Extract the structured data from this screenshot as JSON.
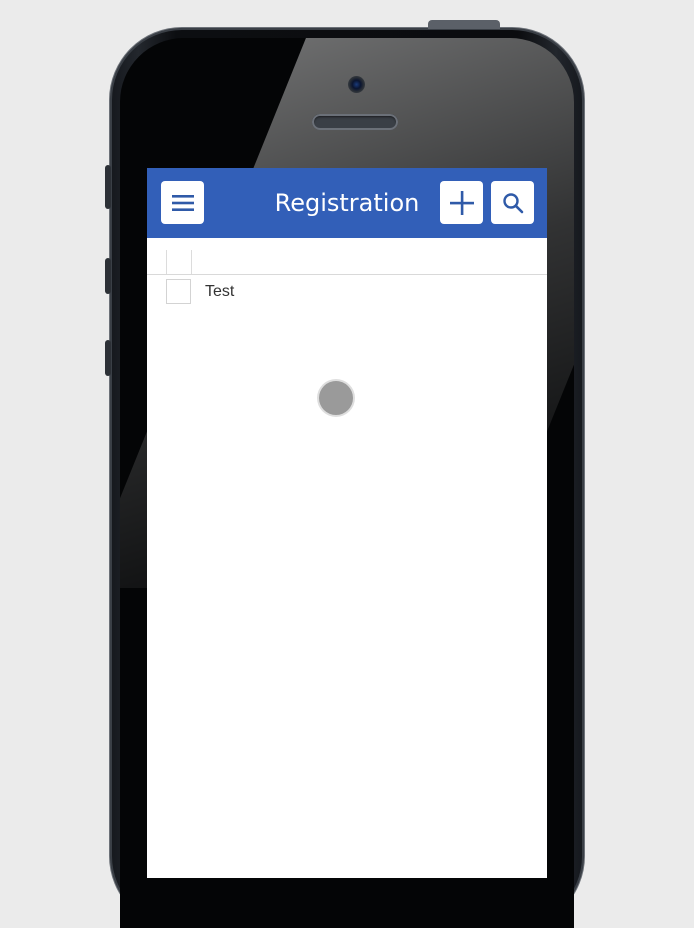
{
  "navbar": {
    "title": "Registration",
    "menu_icon": "hamburger-menu-icon",
    "add_icon": "plus-icon",
    "search_icon": "search-icon",
    "color": "#325fb8"
  },
  "list": {
    "items": [
      {
        "label": "Test",
        "checked": false
      }
    ]
  },
  "loading_indicator": "spinner"
}
